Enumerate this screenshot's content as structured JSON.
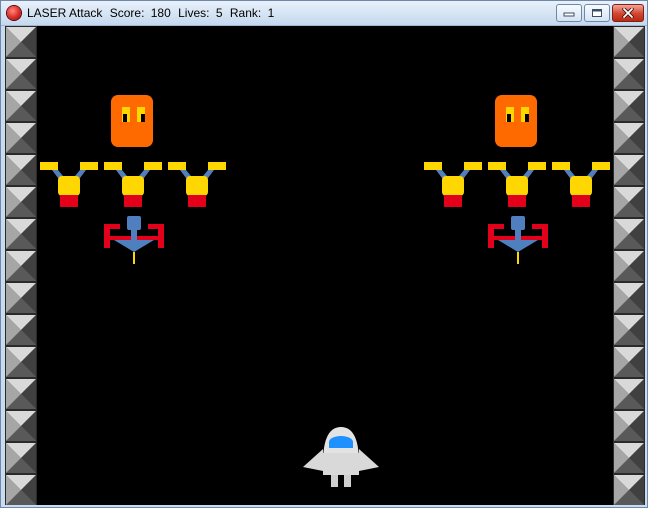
{
  "window": {
    "app_name": "LASER Attack",
    "score_label": "Score:",
    "score": "180",
    "lives_label": "Lives:",
    "lives": "5",
    "rank_label": "Rank:",
    "rank": "1",
    "buttons": {
      "minimize": "minimize",
      "maximize": "maximize",
      "close": "close"
    }
  },
  "icons": {
    "app": "red-orb-icon",
    "minimize": "minimize-icon",
    "maximize": "maximize-icon",
    "close": "close-icon"
  },
  "game": {
    "background": "#000000",
    "wall_blocks_per_side": 15,
    "enemy_groups": [
      {
        "side": "left",
        "boss": "orange-block-alien",
        "fighters": 3,
        "bomber": 1
      },
      {
        "side": "right",
        "boss": "orange-block-alien",
        "fighters": 3,
        "bomber": 1
      }
    ],
    "player": "white-spaceship"
  },
  "colors": {
    "boss": "#ff6a00",
    "fighter_wing": "#ffd700",
    "fighter_arm": "#4f7fbf",
    "fighter_base": "#e3001b",
    "bomber_body": "#4f7fbf",
    "bomber_arms": "#e3001b",
    "player_body": "#d9d9d9",
    "player_cockpit": "#1e90ff"
  }
}
